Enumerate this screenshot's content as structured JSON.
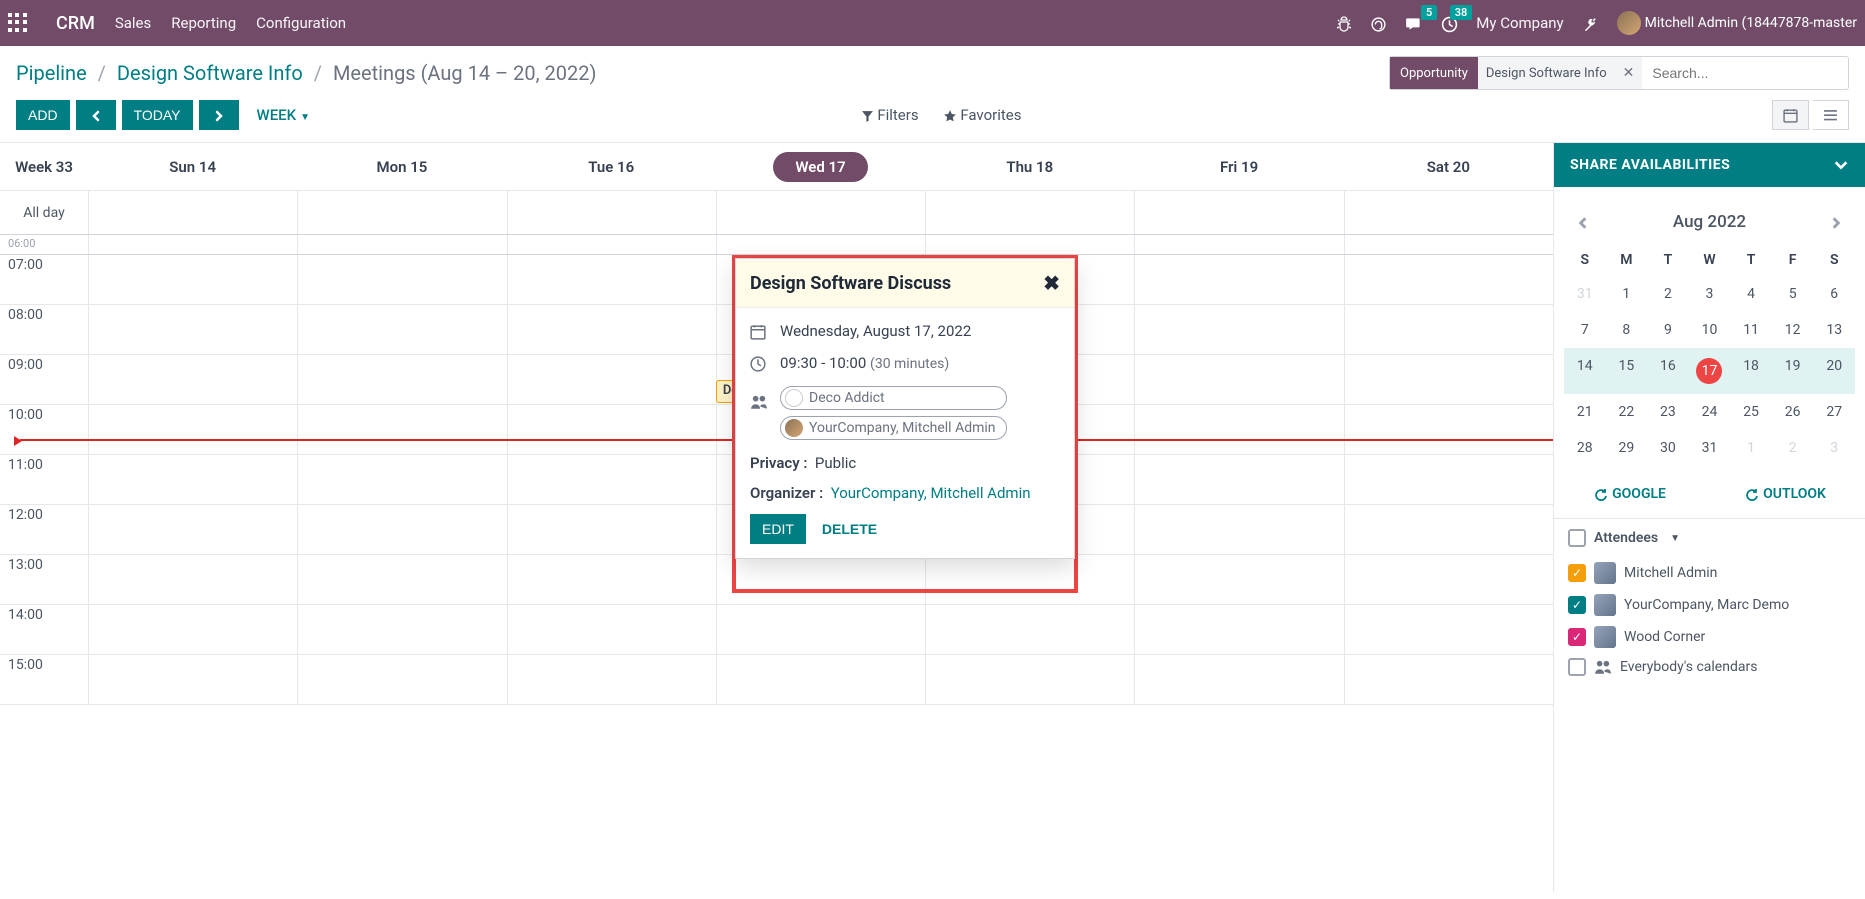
{
  "nav": {
    "brand": "CRM",
    "items": [
      "Sales",
      "Reporting",
      "Configuration"
    ],
    "msg_count": "5",
    "activity_count": "38",
    "company": "My Company",
    "user": "Mitchell Admin (18447878-master"
  },
  "breadcrumb": {
    "root": "Pipeline",
    "mid": "Design Software Info",
    "leaf": "Meetings (Aug 14 – 20, 2022)"
  },
  "search": {
    "tag_label": "Opportunity",
    "tag_value": "Design Software Info",
    "placeholder": "Search..."
  },
  "toolbar": {
    "add": "ADD",
    "today": "TODAY",
    "view": "WEEK",
    "filters": "Filters",
    "favorites": "Favorites"
  },
  "calendar": {
    "week_label": "Week 33",
    "days": [
      "Sun 14",
      "Mon 15",
      "Tue 16",
      "Wed 17",
      "Thu 18",
      "Fri 19",
      "Sat 20"
    ],
    "today_index": 3,
    "allday_label": "All day",
    "hours": [
      "07:00",
      "08:00",
      "09:00",
      "10:00",
      "11:00",
      "12:00",
      "13:00",
      "14:00",
      "15:00"
    ],
    "event_title": "Design Software Disc"
  },
  "popover": {
    "title": "Design Software Discuss",
    "date": "Wednesday, August 17, 2022",
    "time": "09:30 - 10:00",
    "duration": "(30 minutes)",
    "attendee1": "Deco Addict",
    "attendee2": "YourCompany, Mitchell Admin",
    "privacy_label": "Privacy :",
    "privacy_value": "Public",
    "organizer_label": "Organizer :",
    "organizer_value": "YourCompany, Mitchell Admin",
    "edit": "EDIT",
    "delete": "DELETE"
  },
  "sidebar": {
    "share": "SHARE AVAILABILITIES",
    "month": "Aug 2022",
    "dow": [
      "S",
      "M",
      "T",
      "W",
      "T",
      "F",
      "S"
    ],
    "days": [
      {
        "n": "31",
        "other": true
      },
      {
        "n": "1"
      },
      {
        "n": "2"
      },
      {
        "n": "3"
      },
      {
        "n": "4"
      },
      {
        "n": "5"
      },
      {
        "n": "6"
      },
      {
        "n": "7"
      },
      {
        "n": "8"
      },
      {
        "n": "9"
      },
      {
        "n": "10"
      },
      {
        "n": "11"
      },
      {
        "n": "12"
      },
      {
        "n": "13"
      },
      {
        "n": "14",
        "hl": true
      },
      {
        "n": "15",
        "hl": true
      },
      {
        "n": "16",
        "hl": true
      },
      {
        "n": "17",
        "hl": true,
        "today": true
      },
      {
        "n": "18",
        "hl": true
      },
      {
        "n": "19",
        "hl": true
      },
      {
        "n": "20",
        "hl": true
      },
      {
        "n": "21"
      },
      {
        "n": "22"
      },
      {
        "n": "23"
      },
      {
        "n": "24"
      },
      {
        "n": "25"
      },
      {
        "n": "26"
      },
      {
        "n": "27"
      },
      {
        "n": "28"
      },
      {
        "n": "29"
      },
      {
        "n": "30"
      },
      {
        "n": "31"
      },
      {
        "n": "1",
        "other": true
      },
      {
        "n": "2",
        "other": true
      },
      {
        "n": "3",
        "other": true
      }
    ],
    "sync_google": "GOOGLE",
    "sync_outlook": "OUTLOOK",
    "attendees_label": "Attendees",
    "attendees": [
      {
        "name": "Mitchell Admin",
        "color": "gold",
        "checked": true
      },
      {
        "name": "YourCompany, Marc Demo",
        "color": "teal",
        "checked": true
      },
      {
        "name": "Wood Corner",
        "color": "pink",
        "checked": true
      },
      {
        "name": "Everybody's calendars",
        "color": "",
        "checked": false
      }
    ]
  }
}
